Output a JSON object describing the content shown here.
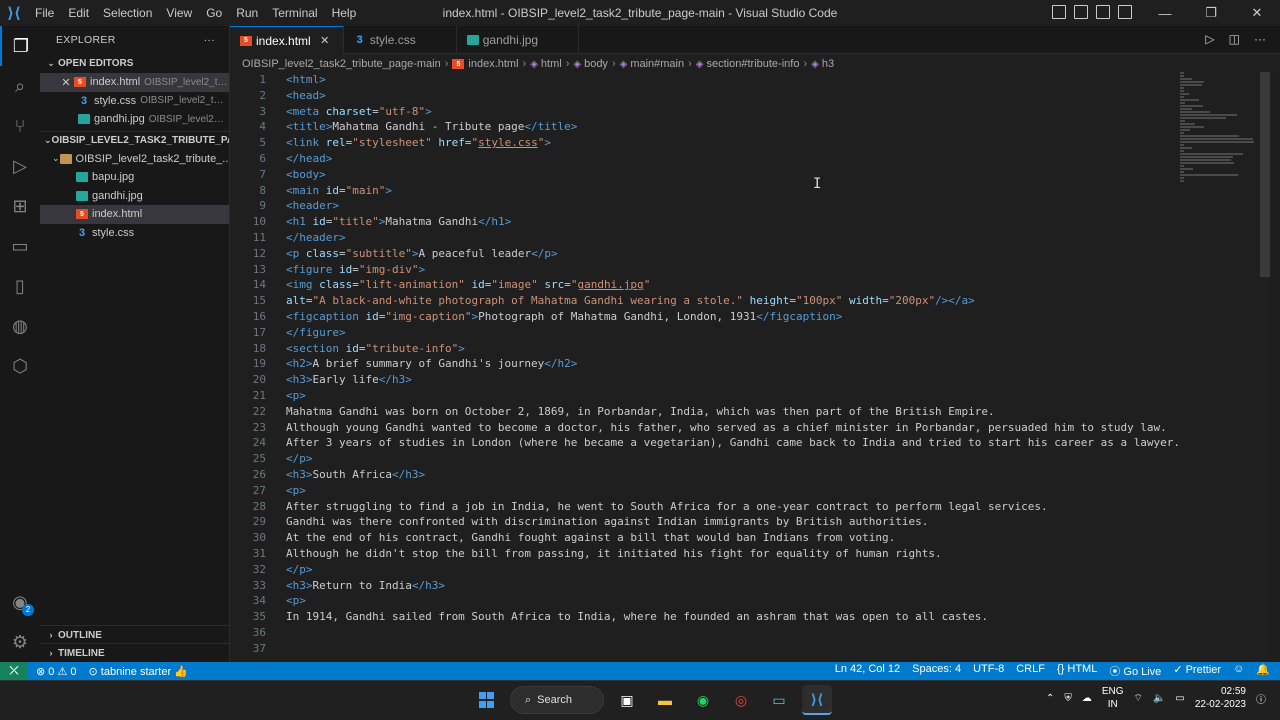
{
  "window": {
    "title": "index.html - OIBSIP_level2_task2_tribute_page-main - Visual Studio Code",
    "menu": [
      "File",
      "Edit",
      "Selection",
      "View",
      "Go",
      "Run",
      "Terminal",
      "Help"
    ]
  },
  "sidebar": {
    "title": "EXPLORER",
    "more": "···",
    "open_editors_label": "OPEN EDITORS",
    "open_editors": [
      {
        "name": "index.html",
        "desc": "OIBSIP_level2_ta...",
        "type": "html"
      },
      {
        "name": "style.css",
        "desc": "OIBSIP_level2_task2...",
        "type": "css"
      },
      {
        "name": "gandhi.jpg",
        "desc": "OIBSIP_level2_ta...",
        "type": "img"
      }
    ],
    "workspace_label": "OIBSIP_LEVEL2_TASK2_TRIBUTE_PAGE...",
    "folder": "OIBSIP_level2_task2_tribute_...",
    "files": [
      {
        "name": "bapu.jpg",
        "type": "img"
      },
      {
        "name": "gandhi.jpg",
        "type": "img"
      },
      {
        "name": "index.html",
        "type": "html"
      },
      {
        "name": "style.css",
        "type": "css"
      }
    ],
    "outline_label": "OUTLINE",
    "timeline_label": "TIMELINE"
  },
  "account_badge": "2",
  "tabs": [
    {
      "label": "index.html",
      "type": "html"
    },
    {
      "label": "style.css",
      "type": "css"
    },
    {
      "label": "gandhi.jpg",
      "type": "img"
    }
  ],
  "breadcrumb": [
    "OIBSIP_level2_task2_tribute_page-main",
    "index.html",
    "html",
    "body",
    "main#main",
    "section#tribute-info",
    "h3"
  ],
  "statusbar": {
    "errors": "0",
    "warnings": "0",
    "tabnine": "tabnine starter",
    "position": "Ln 42, Col 12",
    "spaces": "Spaces: 4",
    "encoding": "UTF-8",
    "eol": "CRLF",
    "language": "HTML",
    "golive": "Go Live",
    "prettier": "Prettier"
  },
  "taskbar": {
    "search": "Search",
    "lang_top": "ENG",
    "lang_bottom": "IN",
    "time": "02:59",
    "date": "22-02-2023"
  },
  "code_lines": [
    [
      [
        "t",
        "<html>"
      ]
    ],
    [
      [
        "t",
        "<head>"
      ]
    ],
    [
      [
        "t",
        "<meta "
      ],
      [
        "a",
        "charset"
      ],
      [
        "x",
        "="
      ],
      [
        "s",
        "\"utf-8\""
      ],
      [
        "t",
        ">"
      ]
    ],
    [
      [
        "t",
        "<title>"
      ],
      [
        "x",
        "Mahatma Gandhi - Tribute page"
      ],
      [
        "t",
        "</title>"
      ]
    ],
    [
      [
        "t",
        "<link "
      ],
      [
        "a",
        "rel"
      ],
      [
        "x",
        "="
      ],
      [
        "s",
        "\"stylesheet\""
      ],
      [
        "x",
        " "
      ],
      [
        "a",
        "href"
      ],
      [
        "x",
        "="
      ],
      [
        "s",
        "\""
      ],
      [
        "u",
        "style.css"
      ],
      [
        "s",
        "\""
      ],
      [
        "t",
        ">"
      ]
    ],
    [
      [
        "t",
        "</head>"
      ]
    ],
    [
      [
        "t",
        "<body>"
      ]
    ],
    [
      [
        "t",
        "<main "
      ],
      [
        "a",
        "id"
      ],
      [
        "x",
        "="
      ],
      [
        "s",
        "\"main\""
      ],
      [
        "t",
        ">"
      ]
    ],
    [
      [
        "t",
        "<header>"
      ]
    ],
    [
      [
        "t",
        "<h1 "
      ],
      [
        "a",
        "id"
      ],
      [
        "x",
        "="
      ],
      [
        "s",
        "\"title\""
      ],
      [
        "t",
        ">"
      ],
      [
        "x",
        "Mahatma Gandhi"
      ],
      [
        "t",
        "</h1>"
      ]
    ],
    [
      [
        "t",
        "</header>"
      ]
    ],
    [
      [
        "t",
        "<p "
      ],
      [
        "a",
        "class"
      ],
      [
        "x",
        "="
      ],
      [
        "s",
        "\"subtitle\""
      ],
      [
        "t",
        ">"
      ],
      [
        "x",
        "A peaceful leader"
      ],
      [
        "t",
        "</p>"
      ]
    ],
    [
      [
        "t",
        "<figure "
      ],
      [
        "a",
        "id"
      ],
      [
        "x",
        "="
      ],
      [
        "s",
        "\"img-div\""
      ],
      [
        "t",
        ">"
      ]
    ],
    [
      [
        "t",
        "<img "
      ],
      [
        "a",
        "class"
      ],
      [
        "x",
        "="
      ],
      [
        "s",
        "\"lift-animation\""
      ],
      [
        "x",
        " "
      ],
      [
        "a",
        "id"
      ],
      [
        "x",
        "="
      ],
      [
        "s",
        "\"image\""
      ],
      [
        "x",
        " "
      ],
      [
        "a",
        "src"
      ],
      [
        "x",
        "="
      ],
      [
        "s",
        "\""
      ],
      [
        "u",
        "gandhi.jpg"
      ],
      [
        "s",
        "\""
      ]
    ],
    [
      [
        "a",
        "alt"
      ],
      [
        "x",
        "="
      ],
      [
        "s",
        "\"A black-and-white photograph of Mahatma Gandhi wearing a stole.\""
      ],
      [
        "x",
        " "
      ],
      [
        "a",
        "height"
      ],
      [
        "x",
        "="
      ],
      [
        "s",
        "\"100px\""
      ],
      [
        "x",
        " "
      ],
      [
        "a",
        "width"
      ],
      [
        "x",
        "="
      ],
      [
        "s",
        "\"200px\""
      ],
      [
        "t",
        "/></a>"
      ]
    ],
    [
      [
        "t",
        "<figcaption "
      ],
      [
        "a",
        "id"
      ],
      [
        "x",
        "="
      ],
      [
        "s",
        "\"img-caption\""
      ],
      [
        "t",
        ">"
      ],
      [
        "x",
        "Photograph of Mahatma Gandhi, London, 1931"
      ],
      [
        "t",
        "</figcaption>"
      ]
    ],
    [
      [
        "t",
        "</figure>"
      ]
    ],
    [
      [
        "t",
        "<section "
      ],
      [
        "a",
        "id"
      ],
      [
        "x",
        "="
      ],
      [
        "s",
        "\"tribute-info\""
      ],
      [
        "t",
        ">"
      ]
    ],
    [
      [
        "t",
        "<h2>"
      ],
      [
        "x",
        "A brief summary of Gandhi's journey"
      ],
      [
        "t",
        "</h2>"
      ]
    ],
    [
      [
        "t",
        "<h3>"
      ],
      [
        "x",
        "Early life"
      ],
      [
        "t",
        "</h3>"
      ]
    ],
    [
      [
        "t",
        "<p>"
      ]
    ],
    [
      [
        "x",
        "Mahatma Gandhi was born on October 2, 1869, in Porbandar, India, which was then part of the British Empire."
      ]
    ],
    [
      [
        "x",
        "Although young Gandhi wanted to become a doctor, his father, who served as a chief minister in Porbandar, persuaded him to study law."
      ]
    ],
    [
      [
        "x",
        "After 3 years of studies in London (where he became a vegetarian), Gandhi came back to India and tried to start his career as a lawyer."
      ]
    ],
    [
      [
        "t",
        "</p>"
      ]
    ],
    [
      [
        "t",
        "<h3>"
      ],
      [
        "x",
        "South Africa"
      ],
      [
        "t",
        "</h3>"
      ]
    ],
    [
      [
        "t",
        "<p>"
      ]
    ],
    [
      [
        "x",
        "After struggling to find a job in India, he went to South Africa for a one-year contract to perform legal services."
      ]
    ],
    [
      [
        "x",
        "Gandhi was there confronted with discrimination against Indian immigrants by British authorities."
      ]
    ],
    [
      [
        "x",
        "At the end of his contract, Gandhi fought against a bill that would ban Indians from voting."
      ]
    ],
    [
      [
        "x",
        "Although he didn't stop the bill from passing, it initiated his fight for equality of human rights."
      ]
    ],
    [
      [
        "t",
        "</p>"
      ]
    ],
    [
      [
        "t",
        "<h3>"
      ],
      [
        "x",
        "Return to India"
      ],
      [
        "t",
        "</h3>"
      ]
    ],
    [
      [
        "t",
        "<p>"
      ]
    ],
    [
      [
        "x",
        "In 1914, Gandhi sailed from South Africa to India, where he founded an ashram that was open to all castes."
      ]
    ],
    [],
    []
  ]
}
